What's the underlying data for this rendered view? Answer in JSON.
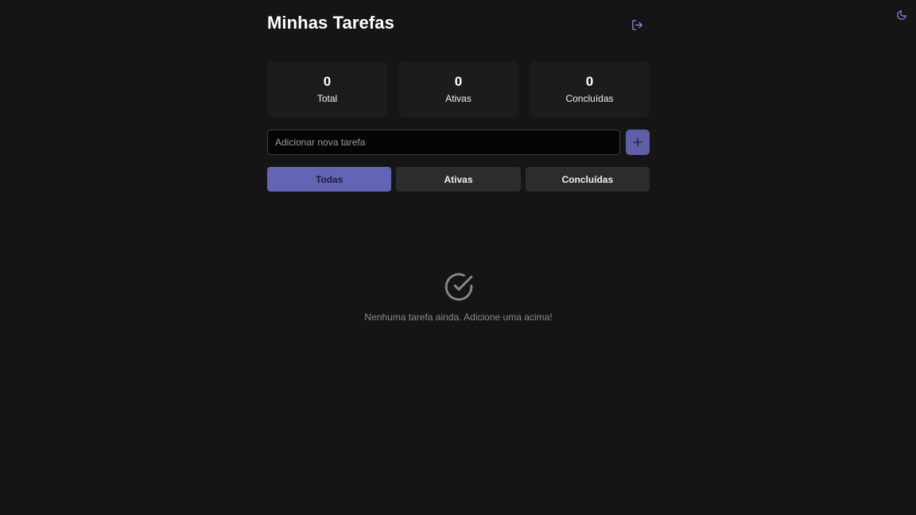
{
  "header": {
    "title": "Minhas Tarefas",
    "logout_icon": "logout-icon",
    "theme_icon": "moon-icon"
  },
  "stats": [
    {
      "value": "0",
      "label": "Total"
    },
    {
      "value": "0",
      "label": "Ativas"
    },
    {
      "value": "0",
      "label": "Concluídas"
    }
  ],
  "add_task": {
    "placeholder": "Adicionar nova tarefa",
    "value": "",
    "button_icon": "plus-icon"
  },
  "filters": {
    "active": "Todas",
    "tabs": [
      "Todas",
      "Ativas",
      "Concluídas"
    ]
  },
  "empty_state": {
    "icon": "check-circle-icon",
    "message": "Nenhuma tarefa ainda. Adicione uma acima!"
  },
  "colors": {
    "background": "#151515",
    "card": "#1c1c1c",
    "accent": "#6464b4",
    "accent_icon": "#8b8bf0",
    "tab": "#2c2c2e",
    "muted_text": "#8a8a8a"
  }
}
